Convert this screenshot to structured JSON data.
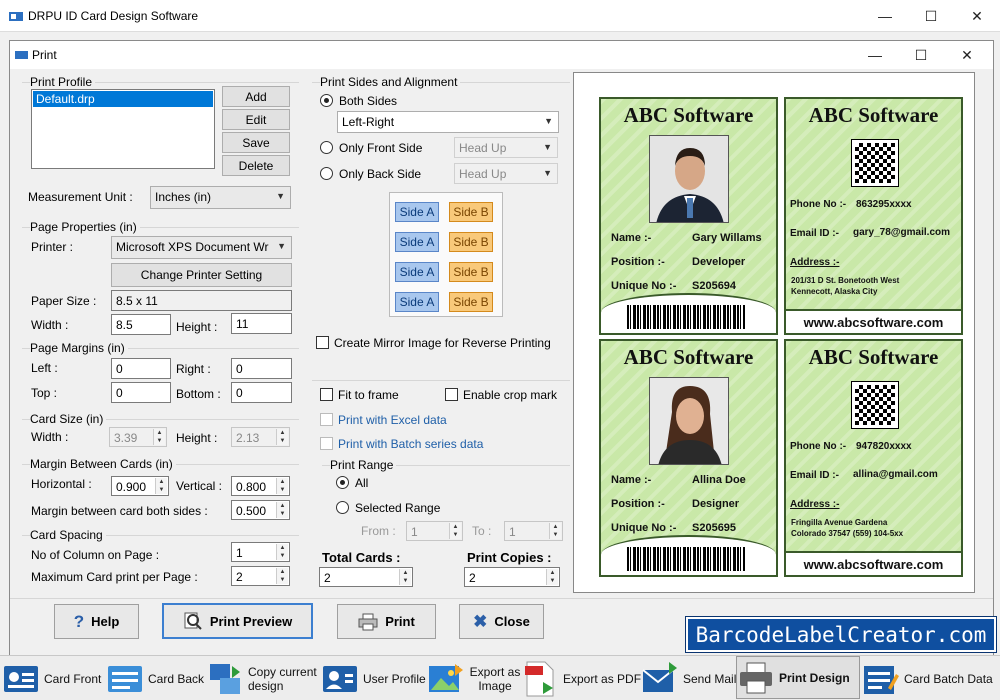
{
  "app": {
    "title": "DRPU ID Card Design Software"
  },
  "dialog": {
    "title": "Print"
  },
  "print_profile": {
    "label": "Print Profile",
    "items": [
      "Default.drp"
    ],
    "add": "Add",
    "edit": "Edit",
    "save": "Save",
    "delete": "Delete"
  },
  "measurement": {
    "label": "Measurement Unit :",
    "value": "Inches (in)"
  },
  "page_properties": {
    "label": "Page Properties (in)",
    "printer_label": "Printer :",
    "printer_value": "Microsoft XPS Document Wr",
    "change_printer": "Change Printer Setting",
    "paper_size_label": "Paper Size :",
    "paper_size_value": "8.5 x 11",
    "width_label": "Width :",
    "width_value": "8.5",
    "height_label": "Height :",
    "height_value": "11"
  },
  "page_margins": {
    "label": "Page Margins (in)",
    "left_label": "Left :",
    "left_value": "0",
    "right_label": "Right :",
    "right_value": "0",
    "top_label": "Top :",
    "top_value": "0",
    "bottom_label": "Bottom :",
    "bottom_value": "0"
  },
  "card_size": {
    "label": "Card Size (in)",
    "width_label": "Width :",
    "width_value": "3.39",
    "height_label": "Height :",
    "height_value": "2.13"
  },
  "margin_between": {
    "label": "Margin Between Cards (in)",
    "horizontal_label": "Horizontal :",
    "horizontal_value": "0.900",
    "vertical_label": "Vertical :",
    "vertical_value": "0.800",
    "both_label": "Margin between card both sides :",
    "both_value": "0.500"
  },
  "card_spacing": {
    "label": "Card Spacing",
    "columns_label": "No of Column on Page :",
    "columns_value": "1",
    "max_label": "Maximum Card print per Page :",
    "max_value": "2"
  },
  "sides": {
    "label": "Print Sides and Alignment",
    "both": "Both Sides",
    "both_value": "Left-Right",
    "front": "Only Front Side",
    "front_value": "Head Up",
    "back": "Only Back Side",
    "back_value": "Head Up",
    "side_a": "Side A",
    "side_b": "Side B",
    "mirror": "Create Mirror Image for Reverse Printing"
  },
  "options": {
    "fit": "Fit to frame",
    "crop": "Enable crop mark",
    "excel": "Print with Excel data",
    "batch": "Print with Batch series data"
  },
  "print_range": {
    "label": "Print Range",
    "all": "All",
    "selected": "Selected Range",
    "from_label": "From :",
    "from_value": "1",
    "to_label": "To :",
    "to_value": "1"
  },
  "totals": {
    "total_label": "Total Cards :",
    "total_value": "2",
    "copies_label": "Print Copies :",
    "copies_value": "2"
  },
  "buttons": {
    "help": "Help",
    "preview": "Print Preview",
    "print": "Print",
    "close": "Close"
  },
  "cards": [
    {
      "company": "ABC Software",
      "name_label": "Name :-",
      "name": "Gary Willams",
      "position_label": "Position :-",
      "position": "Developer",
      "unique_label": "Unique No :-",
      "unique": "S205694",
      "phone_label": "Phone No :-",
      "phone": "863295xxxx",
      "email_label": "Email ID :-",
      "email": "gary_78@gmail.com",
      "address_label": "Address :-",
      "address1": "201/31 D St. Bonetooth West",
      "address2": "Kennecott, Alaska City",
      "website": "www.abcsoftware.com"
    },
    {
      "company": "ABC Software",
      "name_label": "Name :-",
      "name": "Allina Doe",
      "position_label": "Position :-",
      "position": "Designer",
      "unique_label": "Unique No :-",
      "unique": "S205695",
      "phone_label": "Phone No :-",
      "phone": "947820xxxx",
      "email_label": "Email ID :-",
      "email": "allina@gmail.com",
      "address_label": "Address :-",
      "address1": "Fringilla Avenue Gardena",
      "address2": "Colorado 37547 (559) 104-5xx",
      "website": "www.abcsoftware.com"
    }
  ],
  "watermark": "BarcodeLabelCreator.com",
  "taskbar": [
    {
      "label": "Card Front",
      "icon": "card-front-icon"
    },
    {
      "label": "Card Back",
      "icon": "card-back-icon"
    },
    {
      "label": "Copy current design",
      "icon": "copy-design-icon"
    },
    {
      "label": "User Profile",
      "icon": "user-profile-icon"
    },
    {
      "label": "Export as Image",
      "icon": "export-image-icon"
    },
    {
      "label": "Export as PDF",
      "icon": "export-pdf-icon"
    },
    {
      "label": "Send Mail",
      "icon": "send-mail-icon"
    },
    {
      "label": "Print Design",
      "icon": "printer-icon"
    },
    {
      "label": "Card Batch Data",
      "icon": "batch-data-icon"
    }
  ],
  "colors": {
    "card_green": "#c9e8a8",
    "card_border": "#3a5a2a",
    "selection": "#0078d7",
    "watermark_bg": "#0f4fa0"
  }
}
